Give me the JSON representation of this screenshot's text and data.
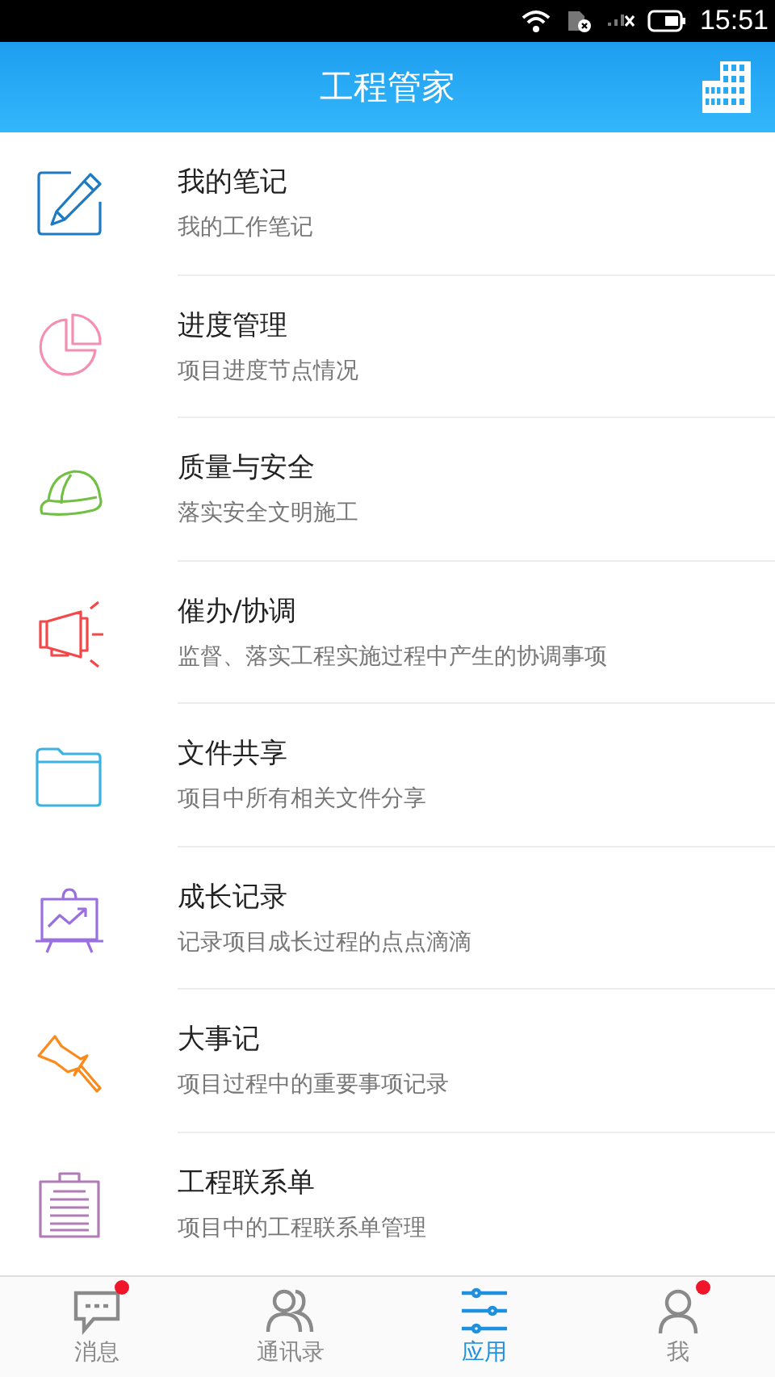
{
  "status_bar": {
    "time": "15:51"
  },
  "header": {
    "title": "工程管家"
  },
  "items": [
    {
      "kind": "note",
      "color": "#1f7ac4",
      "title": "我的笔记",
      "subtitle": "我的工作笔记"
    },
    {
      "kind": "pie",
      "color": "#f58fb0",
      "title": "进度管理",
      "subtitle": "项目进度节点情况"
    },
    {
      "kind": "helmet",
      "color": "#72c043",
      "title": "质量与安全",
      "subtitle": "落实安全文明施工"
    },
    {
      "kind": "megaphone",
      "color": "#f4474a",
      "title": "催办/协调",
      "subtitle": "监督、落实工程实施过程中产生的协调事项"
    },
    {
      "kind": "folder",
      "color": "#3bb2e0",
      "title": "文件共享",
      "subtitle": "项目中所有相关文件分享"
    },
    {
      "kind": "chart",
      "color": "#9a6fe0",
      "title": "成长记录",
      "subtitle": "记录项目成长过程的点点滴滴"
    },
    {
      "kind": "pin",
      "color": "#fb8a1c",
      "title": "大事记",
      "subtitle": "项目过程中的重要事项记录"
    },
    {
      "kind": "clipboard",
      "color": "#b07cb5",
      "title": "工程联系单",
      "subtitle": "项目中的工程联系单管理"
    }
  ],
  "tabs": [
    {
      "kind": "message",
      "label": "消息",
      "selected": false,
      "unread": true
    },
    {
      "kind": "contacts",
      "label": "通讯录",
      "selected": false,
      "unread": false
    },
    {
      "kind": "apps",
      "label": "应用",
      "selected": true,
      "unread": false
    },
    {
      "kind": "me",
      "label": "我",
      "selected": false,
      "unread": true
    }
  ]
}
